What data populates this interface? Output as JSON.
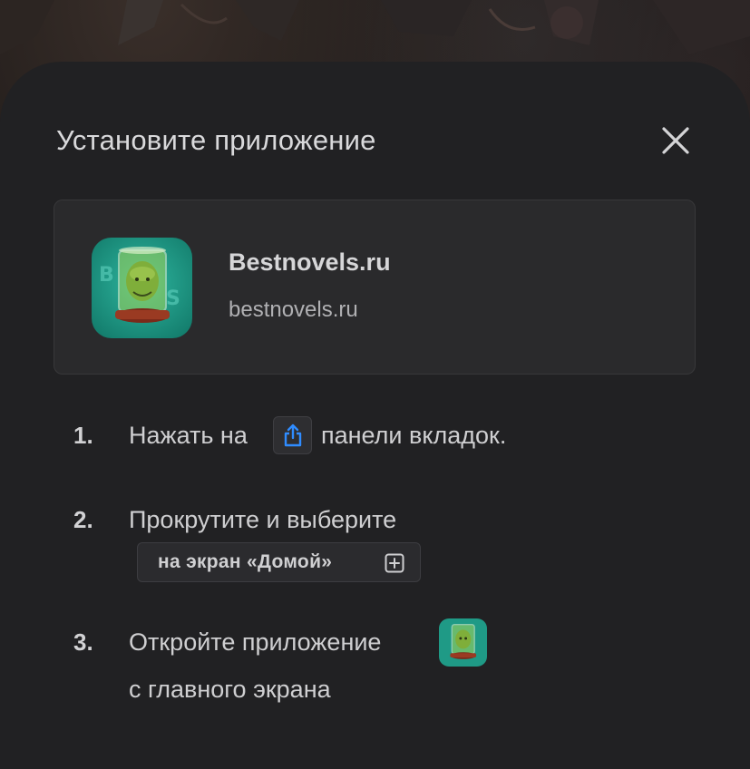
{
  "sheet": {
    "title": "Установите приложение",
    "close_icon": "close-icon"
  },
  "app": {
    "name": "Bestnovels.ru",
    "url": "bestnovels.ru",
    "icon": "app-logo-icon"
  },
  "steps": [
    {
      "number": "1.",
      "text_before": "Нажать на",
      "icon": "share-icon",
      "text_after": "панели вкладок."
    },
    {
      "number": "2.",
      "text": "Прокрутите и выберите",
      "chip_label": "на экран «Домой»",
      "chip_icon": "add-square-icon"
    },
    {
      "number": "3.",
      "text_line1": "Откройте приложение",
      "icon": "app-logo-icon",
      "text_line2": "с главного экрана"
    }
  ],
  "colors": {
    "sheet_bg": "#212123",
    "card_bg": "#2a2a2c",
    "accent_blue": "#2f8cff",
    "icon_teal": "#1f9a86"
  }
}
